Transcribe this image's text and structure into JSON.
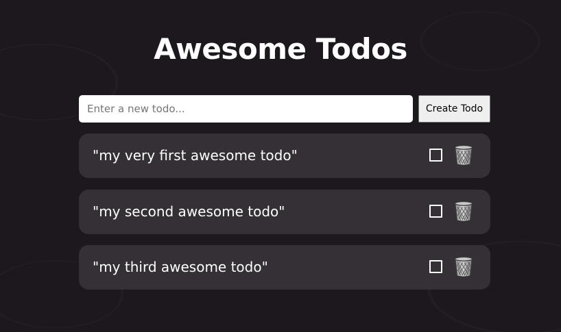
{
  "header": {
    "title": "Awesome Todos"
  },
  "new_todo": {
    "placeholder": "Enter a new todo...",
    "value": "",
    "create_label": "Create Todo"
  },
  "todos": [
    {
      "text": "\"my very first awesome todo\"",
      "completed": false,
      "delete_icon": "wastebasket-icon"
    },
    {
      "text": "\"my second awesome todo\"",
      "completed": false,
      "delete_icon": "wastebasket-icon"
    },
    {
      "text": "\"my third awesome todo\"",
      "completed": false,
      "delete_icon": "wastebasket-icon"
    }
  ],
  "colors": {
    "background": "#1c181e",
    "card": "#3a363c",
    "text": "#ffffff"
  }
}
